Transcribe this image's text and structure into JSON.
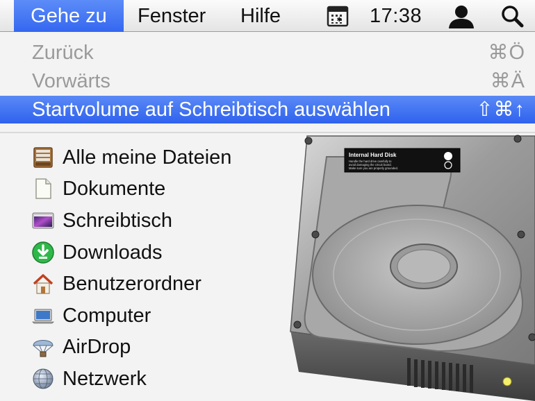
{
  "menubar": {
    "menus": [
      "Gehe zu",
      "Fenster",
      "Hilfe"
    ],
    "active_menu": "Gehe zu",
    "clock": "17:38",
    "icons": [
      "calendar-icon",
      "user-icon",
      "search-icon"
    ]
  },
  "dropdown": {
    "items": [
      {
        "label": "Zurück",
        "shortcut": "⌘Ö",
        "state": "disabled"
      },
      {
        "label": "Vorwärts",
        "shortcut": "⌘Ä",
        "state": "disabled"
      },
      {
        "label": "Startvolume auf Schreibtisch auswählen",
        "shortcut": "⇧⌘↑",
        "state": "highlighted"
      }
    ],
    "places": [
      {
        "label": "Alle meine Dateien",
        "icon": "all-files-icon"
      },
      {
        "label": "Dokumente",
        "icon": "document-icon"
      },
      {
        "label": "Schreibtisch",
        "icon": "desktop-icon"
      },
      {
        "label": "Downloads",
        "icon": "downloads-icon"
      },
      {
        "label": "Benutzerordner",
        "icon": "home-icon"
      },
      {
        "label": "Computer",
        "icon": "computer-icon"
      },
      {
        "label": "AirDrop",
        "icon": "airdrop-icon"
      },
      {
        "label": "Netzwerk",
        "icon": "network-icon"
      }
    ]
  },
  "hard_disk": {
    "label_title": "Internal Hard Disk",
    "label_lines": [
      "Handle the hard drive carefully to",
      "avoid damaging the circuit board.",
      "Make sure you are properly grounded."
    ]
  },
  "colors": {
    "highlight": "#3467f0",
    "menubar_bg": "#ececec",
    "disabled_text": "#9a9a9a"
  }
}
